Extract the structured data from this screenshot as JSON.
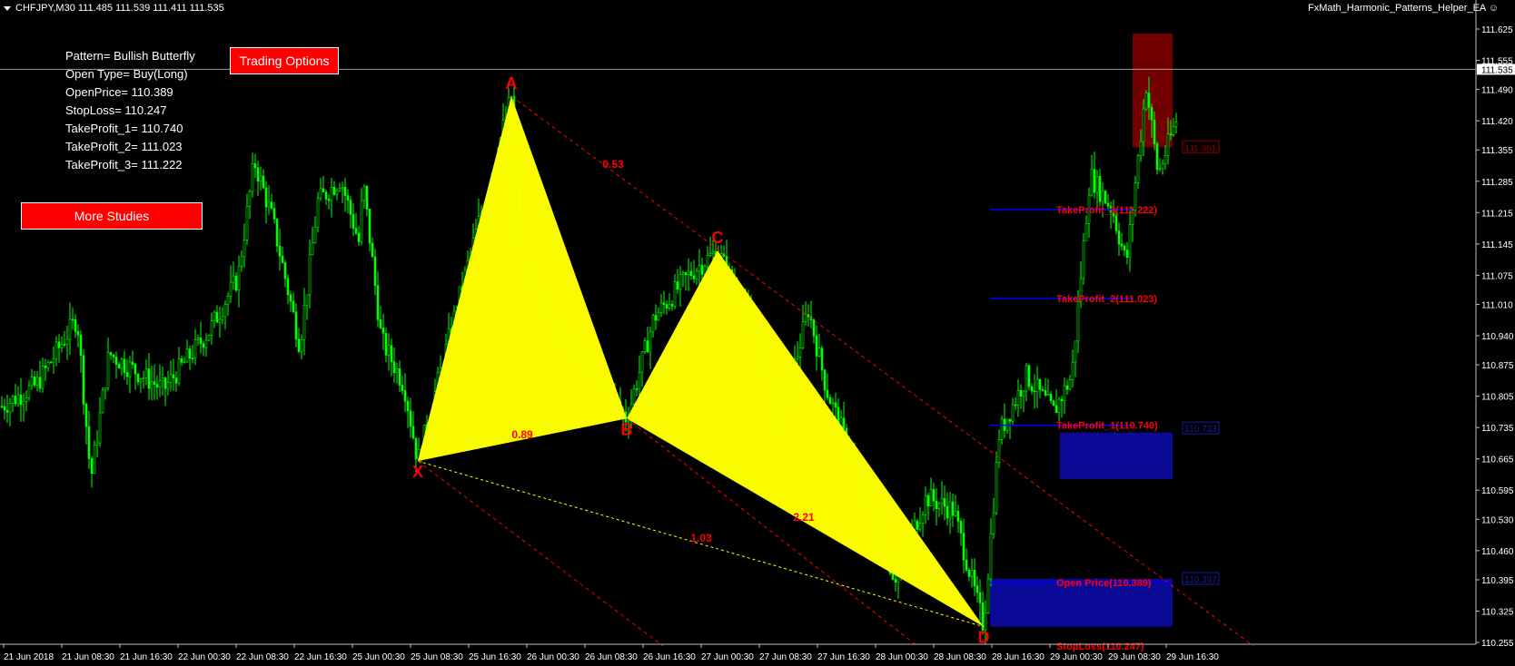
{
  "window": {
    "symbol_info": "CHFJPY,M30  111.485 111.539 111.411 111.535",
    "ea_name": "FxMath_Harmonic_Patterns_Helper_EA"
  },
  "info_panel": {
    "lines": [
      "Pattern= Bullish Butterfly",
      "Open Type= Buy(Long)",
      "OpenPrice= 110.389",
      "StopLoss= 110.247",
      "TakeProfit_1= 110.740",
      "TakeProfit_2= 111.023",
      "TakeProfit_3= 111.222"
    ]
  },
  "buttons": {
    "trading_options": "Trading Options",
    "more_studies": "More Studies"
  },
  "chart_data": {
    "type": "candlestick",
    "symbol": "CHFJPY",
    "timeframe": "M30",
    "y_axis_ticks": [
      "111.625",
      "111.555",
      "111.490",
      "111.420",
      "111.355",
      "111.285",
      "111.215",
      "111.145",
      "111.075",
      "111.010",
      "110.940",
      "110.875",
      "110.805",
      "110.735",
      "110.665",
      "110.595",
      "110.530",
      "110.460",
      "110.395",
      "110.325",
      "110.255"
    ],
    "ylim": [
      110.255,
      111.625
    ],
    "current_price": "111.535",
    "x_axis_ticks": [
      "21 Jun 2018",
      "21 Jun 08:30",
      "21 Jun 16:30",
      "22 Jun 00:30",
      "22 Jun 08:30",
      "22 Jun 16:30",
      "25 Jun 00:30",
      "25 Jun 08:30",
      "25 Jun 16:30",
      "26 Jun 00:30",
      "26 Jun 08:30",
      "26 Jun 16:30",
      "27 Jun 00:30",
      "27 Jun 08:30",
      "27 Jun 16:30",
      "28 Jun 00:30",
      "28 Jun 08:30",
      "28 Jun 16:30",
      "29 Jun 00:30",
      "29 Jun 08:30",
      "29 Jun 16:30"
    ],
    "pattern_points": [
      {
        "label": "X",
        "price": 110.66
      },
      {
        "label": "A",
        "price": 111.475
      },
      {
        "label": "B",
        "price": 110.755
      },
      {
        "label": "C",
        "price": 111.13
      },
      {
        "label": "D",
        "price": 110.29
      }
    ],
    "ratios": [
      "0.53",
      "0.89",
      "2.21",
      "1.03"
    ],
    "levels": [
      {
        "label": "TakeProfit_3(111.222)",
        "price": 111.222
      },
      {
        "label": "TakeProfit_2(111.023)",
        "price": 111.023
      },
      {
        "label": "TakeProfit_1(110.740)",
        "price": 110.74
      },
      {
        "label": "Open Price(110.389)",
        "price": 110.389
      },
      {
        "label": "StopLoss(110.247)",
        "price": 110.247
      }
    ],
    "price_tags": [
      {
        "text": "111.361",
        "color": "#8b0000"
      },
      {
        "text": "110.733",
        "color": "#1a1aa0"
      },
      {
        "text": "110.397",
        "color": "#1a1aa0"
      }
    ],
    "colors": {
      "candles": "#00ff00",
      "pattern": "#ffff00",
      "labels": "#ff0000",
      "level_line": "#0000ff",
      "open_zone": "#0a0a96",
      "tp_zone": "#0a0a96",
      "sl_zone": "#7f0000"
    }
  }
}
